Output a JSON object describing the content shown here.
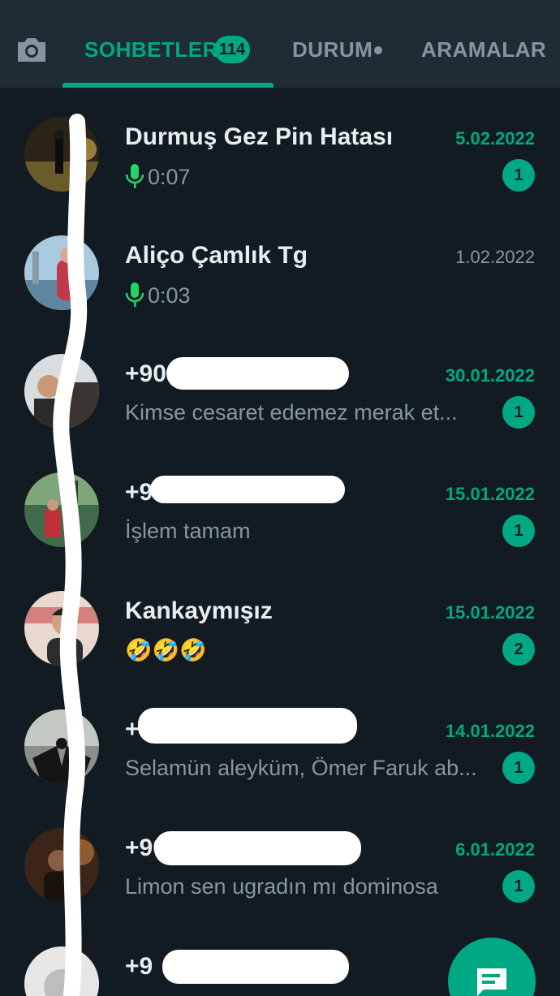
{
  "tabs": {
    "chats_label": "SOHBETLER",
    "chats_count": "114",
    "status_label": "DURUM",
    "calls_label": "ARAMALAR"
  },
  "icons": {
    "camera": "camera-icon",
    "mic": "mic-icon",
    "new_chat": "new-chat-icon"
  },
  "colors": {
    "accent": "#00a884",
    "background": "#111b21",
    "header": "#1f2c34"
  },
  "chats": [
    {
      "name": "Durmuş Gez Pin Hatası",
      "date": "5.02.2022",
      "preview": "0:07",
      "voice": true,
      "unread": "1"
    },
    {
      "name": "Aliço Çamlık Tg",
      "date": "1.02.2022",
      "preview": "0:03",
      "voice": true,
      "unread": ""
    },
    {
      "name": "+90",
      "date": "30.01.2022",
      "preview": "Kimse cesaret edemez merak et...",
      "voice": false,
      "unread": "1"
    },
    {
      "name": "+90",
      "date": "15.01.2022",
      "preview": "İşlem tamam",
      "voice": false,
      "unread": "1"
    },
    {
      "name": "Kankaymışız",
      "date": "15.01.2022",
      "preview": "🤣🤣🤣",
      "voice": false,
      "unread": "2"
    },
    {
      "name": "+",
      "date": "14.01.2022",
      "preview": "Selamün aleyküm, Ömer Faruk ab...",
      "voice": false,
      "unread": "1"
    },
    {
      "name": "+90",
      "date": "6.01.2022",
      "preview": "Limon sen ugradın mı dominosa",
      "voice": false,
      "unread": "1"
    },
    {
      "name": "+9",
      "date": "",
      "preview": "",
      "voice": false,
      "unread": ""
    }
  ]
}
